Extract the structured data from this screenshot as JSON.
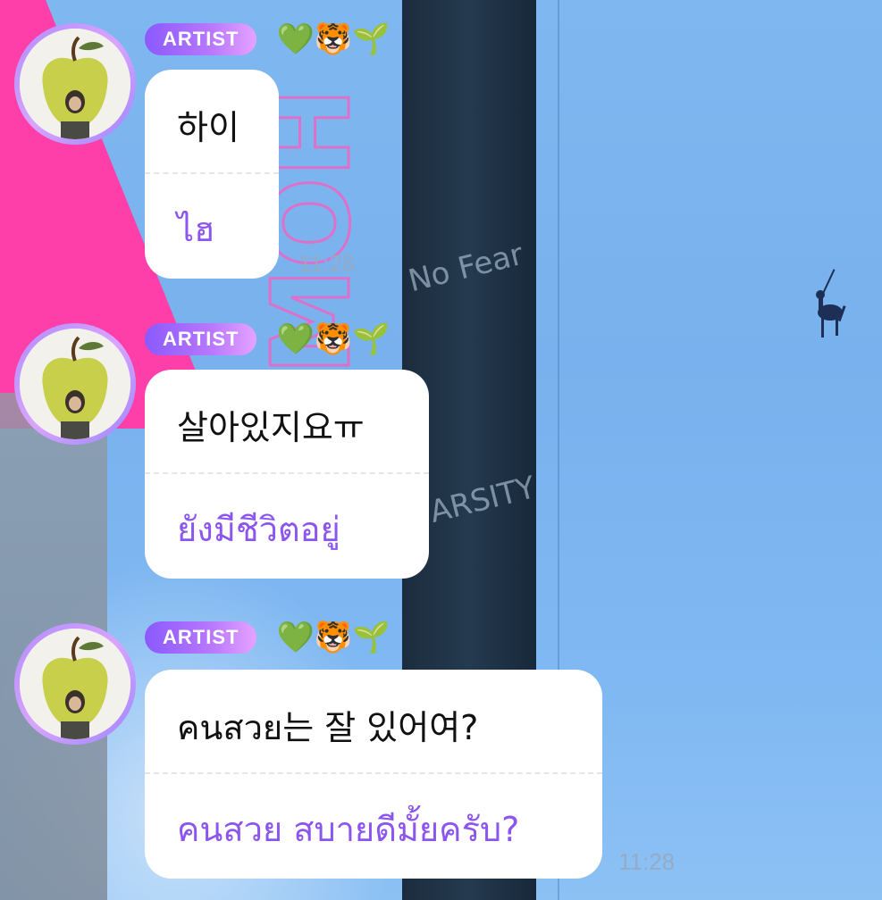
{
  "messages": [
    {
      "badge": "ARTIST",
      "emojis": "💚🐯🌱",
      "original": "하이",
      "translation": "ไฮ",
      "time": "11:28"
    },
    {
      "badge": "ARTIST",
      "emojis": "💚🐯🌱",
      "original": "살아있지요ㅠ",
      "translation": "ยังมีชีวิตอยู่",
      "time": ""
    },
    {
      "badge": "ARTIST",
      "emojis": "💚🐯🌱",
      "original": "คนสวย는 잘 있어여?",
      "translation": "คนสวย สบายดีมั้ยครับ?",
      "time": "11:28"
    }
  ],
  "background": {
    "tie_text_1": "No Fear",
    "tie_text_2": "ARSITY"
  },
  "colors": {
    "badge": "#8a59ff",
    "translation": "#8b55ee",
    "bubble": "#ffffff",
    "shirt": "#7fb7f0",
    "tie": "#1c2c3e",
    "accent_pink": "#ff3fa9"
  }
}
